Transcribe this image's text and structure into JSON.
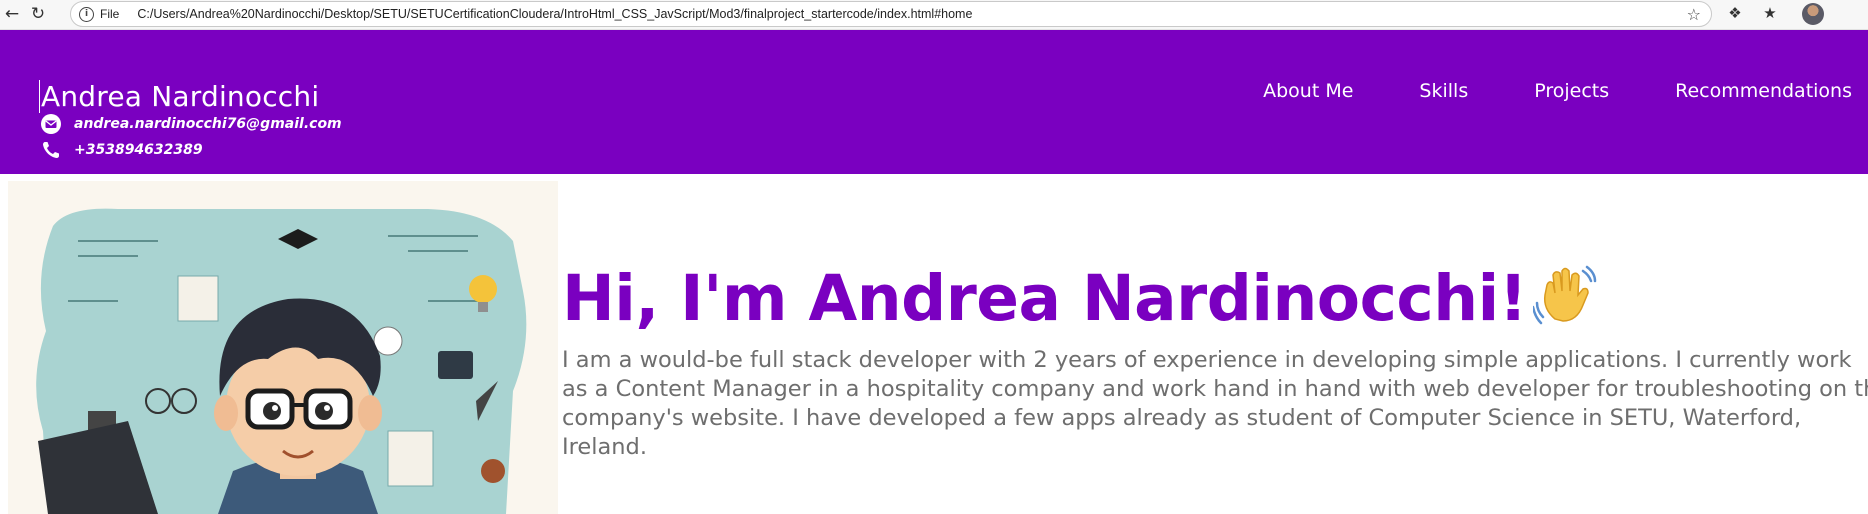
{
  "browser": {
    "file_label": "File",
    "url": "C:/Users/Andrea%20Nardinocchi/Desktop/SETU/SETUCertificationCloudera/IntroHtml_CSS_JavScript/Mod3/finalproject_startercode/index.html#home"
  },
  "header": {
    "name": "Andrea Nardinocchi",
    "email": "andrea.nardinocchi76@gmail.com",
    "phone": "+353894632389",
    "nav": [
      "About Me",
      "Skills",
      "Projects",
      "Recommendations"
    ],
    "bg_color": "#7a00c0"
  },
  "hero": {
    "title": "Hi, I'm Andrea Nardinocchi!",
    "description_lines": [
      "I am a would-be full stack developer with 2 years of experience in developing simple applications. I currently work",
      "as a Content Manager in a hospitality company and work hand in hand with web developer for troubleshooting on the",
      "company's website. I have developed a few apps already as student of Computer Science in SETU, Waterford,",
      "Ireland."
    ],
    "accent_color": "#7a00c0",
    "image_icon": "cartoon-developer-illustration"
  }
}
